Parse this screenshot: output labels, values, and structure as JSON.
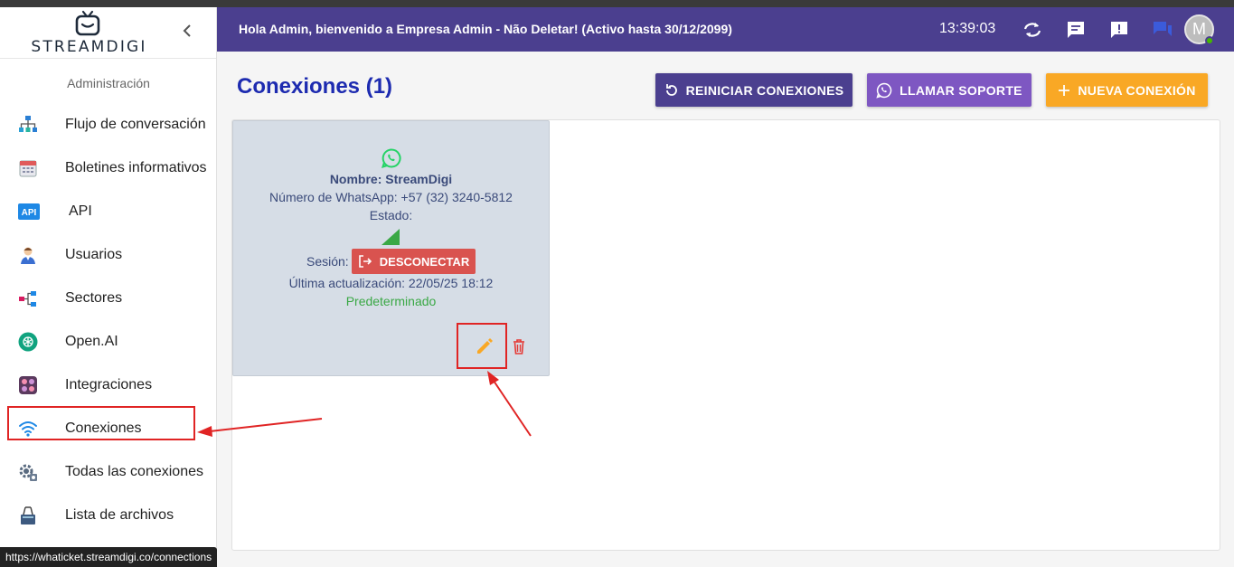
{
  "sidebar": {
    "logo_text": "STREAMDIGI",
    "section_title": "Administración",
    "items": [
      {
        "label": "Flujo de conversación",
        "icon": "flow-chart-icon"
      },
      {
        "label": "Boletines informativos",
        "icon": "calendar-icon"
      },
      {
        "label": "API",
        "icon": "api-badge-icon"
      },
      {
        "label": "Usuarios",
        "icon": "user-icon"
      },
      {
        "label": "Sectores",
        "icon": "sectors-icon"
      },
      {
        "label": "Open.AI",
        "icon": "openai-icon"
      },
      {
        "label": "Integraciones",
        "icon": "integrations-icon"
      },
      {
        "label": "Conexiones",
        "icon": "wifi-icon"
      },
      {
        "label": "Todas las conexiones",
        "icon": "settings-cog-icon"
      },
      {
        "label": "Lista de archivos",
        "icon": "binder-clip-icon"
      }
    ],
    "api_badge": "API"
  },
  "topbar": {
    "welcome": "Hola Admin, bienvenido a Empresa Admin - Não Deletar! (Activo hasta 30/12/2099)",
    "clock": "13:39:03",
    "avatar_letter": "M"
  },
  "main": {
    "title": "Conexiones (1)",
    "buttons": {
      "reset": "REINICIAR CONEXIONES",
      "support": "LLAMAR SOPORTE",
      "new": "NUEVA CONEXIÓN"
    }
  },
  "card": {
    "name": "Nombre: StreamDigi",
    "phone": "Número de WhatsApp: +57 (32) 3240-5812",
    "status_label": "Estado:",
    "session_label": "Sesión:",
    "disconnect": "DESCONECTAR",
    "last_update": "Última actualización: 22/05/25 18:12",
    "default": "Predeterminado"
  },
  "status_url": "https://whaticket.streamdigi.co/connections",
  "colors": {
    "topbar": "#4b3f8f",
    "support": "#7e57c2",
    "new": "#f9a825",
    "disconnect": "#d9534f",
    "highlight": "#e02424"
  }
}
